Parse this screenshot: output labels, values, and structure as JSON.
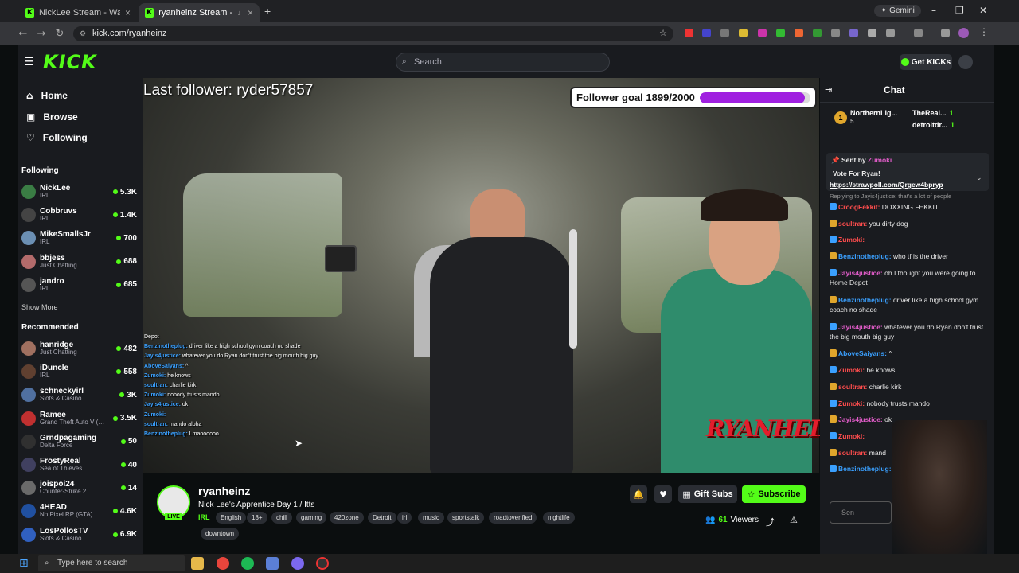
{
  "browser": {
    "tabs": [
      {
        "title": "NickLee Stream - Watch Live o"
      },
      {
        "title": "ryanheinz Stream - Watch L"
      }
    ],
    "url": "kick.com/ryanheinz",
    "profile_button": "Gemini"
  },
  "header": {
    "logo": "KICK",
    "search_placeholder": "Search",
    "get_kicks": "Get KICKs"
  },
  "sidebar": {
    "nav": [
      {
        "label": "Home"
      },
      {
        "label": "Browse"
      },
      {
        "label": "Following"
      }
    ],
    "following_title": "Following",
    "following": [
      {
        "name": "NickLee",
        "category": "IRL",
        "viewers": "5.3K",
        "color": "#3a7d44"
      },
      {
        "name": "Cobbruvs",
        "category": "IRL",
        "viewers": "1.4K",
        "color": "#444"
      },
      {
        "name": "MikeSmallsJr",
        "category": "IRL",
        "viewers": "700",
        "color": "#6b8fb3"
      },
      {
        "name": "bbjess",
        "category": "Just Chatting",
        "viewers": "688",
        "color": "#b36b6b"
      },
      {
        "name": "jandro",
        "category": "IRL",
        "viewers": "685",
        "color": "#555"
      }
    ],
    "show_more": "Show More",
    "recommended_title": "Recommended",
    "recommended": [
      {
        "name": "hanridge",
        "category": "Just Chatting",
        "viewers": "482",
        "color": "#a07060"
      },
      {
        "name": "iDuncle",
        "category": "IRL",
        "viewers": "558",
        "color": "#604030"
      },
      {
        "name": "schneckyirl",
        "category": "Slots & Casino",
        "viewers": "3K",
        "color": "#5070a0"
      },
      {
        "name": "Ramee",
        "category": "Grand Theft Auto V (…",
        "viewers": "3.5K",
        "color": "#c03030"
      },
      {
        "name": "Grndpagaming",
        "category": "Delta Force",
        "viewers": "50",
        "color": "#303030"
      },
      {
        "name": "FrostyReal",
        "category": "Sea of Thieves",
        "viewers": "40",
        "color": "#404060"
      },
      {
        "name": "joispoi24",
        "category": "Counter-Strike 2",
        "viewers": "14",
        "color": "#6a6a6a"
      },
      {
        "name": "4HEAD",
        "category": "No Pixel RP (GTA)",
        "viewers": "4.6K",
        "color": "#2050a0"
      },
      {
        "name": "LosPollosTV",
        "category": "Slots & Casino",
        "viewers": "6.9K",
        "color": "#3060c0"
      }
    ]
  },
  "video": {
    "last_follower": "Last follower: ryder57857",
    "follower_goal": "Follower goal 1899/2000",
    "follower_goal_fraction": 0.95,
    "brand": "RYANHEINZ",
    "overlay_chat": [
      {
        "user": "",
        "text": "Depot"
      },
      {
        "user": "Benzinotheplug:",
        "text": "driver like a high school gym coach no shade"
      },
      {
        "user": "Jayis4justice:",
        "text": "whatever you do Ryan don't trust the big mouth big guy"
      },
      {
        "user": "AboveSaiyans:",
        "text": "^"
      },
      {
        "user": "Zumoki:",
        "text": "he knows"
      },
      {
        "user": "soultran:",
        "text": "charlie kirk"
      },
      {
        "user": "Zumoki:",
        "text": "nobody trusts mando"
      },
      {
        "user": "Jayis4justice:",
        "text": "ok"
      },
      {
        "user": "Zumoki:",
        "text": ""
      },
      {
        "user": "soultran:",
        "text": "mando alpha"
      },
      {
        "user": "Benzinotheplug:",
        "text": "Lmaoooooo"
      }
    ]
  },
  "stream_info": {
    "channel": "ryanheinz",
    "live": "LIVE",
    "title": "Nick Lee's Apprentice Day 1 / Itts",
    "category": "IRL",
    "tags": [
      "English",
      "18+",
      "chill",
      "gaming",
      "420zone",
      "Detroit",
      "irl",
      "music",
      "sportstalk",
      "roadtoverified",
      "nightlife",
      "downtown"
    ],
    "gift_subs": "Gift Subs",
    "subscribe": "Subscribe",
    "viewer_count": "61",
    "viewers_label": "Viewers"
  },
  "chat": {
    "title": "Chat",
    "top_gifters": [
      {
        "name": "NorthernLig...",
        "count": "5"
      },
      {
        "name": "TheReal...",
        "count": "1"
      },
      {
        "name": "detroitdr...",
        "count": "1"
      }
    ],
    "pinned_sender": "Sent by",
    "pinned_user": "Zumoki",
    "pinned_text": "Vote For Ryan!",
    "pinned_link": "https://strawpoll.com/Qrgew4bpryp",
    "reply_note": "Replying to Jayis4justice: that's a lot of people",
    "messages": [
      {
        "user": "CroogFekkit:",
        "text": "DOXXING FEKKIT",
        "color": "#ff4d4d"
      },
      {
        "user": "soultran:",
        "text": "you dirty dog",
        "color": "#ff4d4d"
      },
      {
        "user": "Zumoki:",
        "text": "",
        "color": "#ff4d4d"
      },
      {
        "user": "Benzinotheplug:",
        "text": "who tf is the driver",
        "color": "#3aa0ff"
      },
      {
        "user": "Jayis4justice:",
        "text": "oh I thought you were going to Home Depot",
        "color": "#e05cc8"
      },
      {
        "user": "Benzinotheplug:",
        "text": "driver like a high school gym coach no shade",
        "color": "#3aa0ff"
      },
      {
        "user": "Jayis4justice:",
        "text": "whatever you do Ryan don't trust the big mouth big guy",
        "color": "#e05cc8"
      },
      {
        "user": "AboveSaiyans:",
        "text": "^",
        "color": "#3aa0ff"
      },
      {
        "user": "Zumoki:",
        "text": "he knows",
        "color": "#ff4d4d"
      },
      {
        "user": "soultran:",
        "text": "charlie kirk",
        "color": "#ff4d4d"
      },
      {
        "user": "Zumoki:",
        "text": "nobody trusts mando",
        "color": "#ff4d4d"
      },
      {
        "user": "Jayis4justice:",
        "text": "ok",
        "color": "#e05cc8"
      },
      {
        "user": "Zumoki:",
        "text": "",
        "color": "#ff4d4d"
      },
      {
        "user": "soultran:",
        "text": "mand",
        "color": "#ff4d4d"
      },
      {
        "user": "Benzinotheplug:",
        "text": "",
        "color": "#3aa0ff"
      }
    ],
    "input_placeholder": "Sen"
  },
  "taskbar": {
    "search_placeholder": "Type here to search"
  },
  "colors": {
    "accent": "#53fc18",
    "goal_bar": "#a020e0",
    "brand": "#e31d2c"
  }
}
